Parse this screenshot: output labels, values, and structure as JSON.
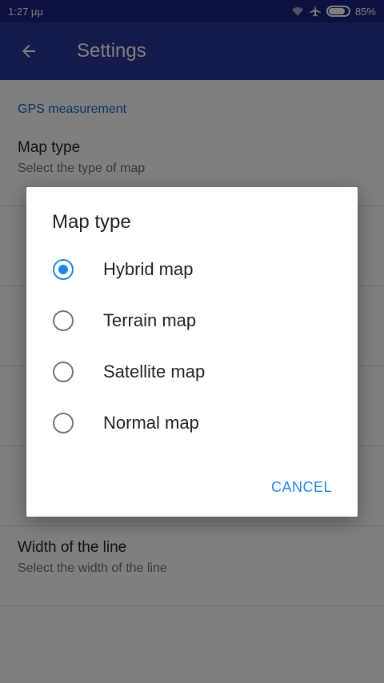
{
  "status_bar": {
    "time": "1:27 μμ",
    "battery": "85%",
    "battery_level": 0.85
  },
  "app_bar": {
    "title": "Settings",
    "back_icon": "arrow-left-icon"
  },
  "settings": {
    "section": "GPS measurement",
    "items": [
      {
        "title": "Map type",
        "subtitle": "Select the type of map"
      },
      {
        "title": "Width of the line",
        "subtitle": "Select the width of the line"
      }
    ]
  },
  "dialog": {
    "title": "Map type",
    "options": [
      {
        "label": "Hybrid map",
        "checked": true
      },
      {
        "label": "Terrain map",
        "checked": false
      },
      {
        "label": "Satellite map",
        "checked": false
      },
      {
        "label": "Normal map",
        "checked": false
      }
    ],
    "cancel_label": "CANCEL"
  },
  "colors": {
    "primary": "#283593",
    "status_bar": "#1a237e",
    "accent": "#1e88e5"
  }
}
